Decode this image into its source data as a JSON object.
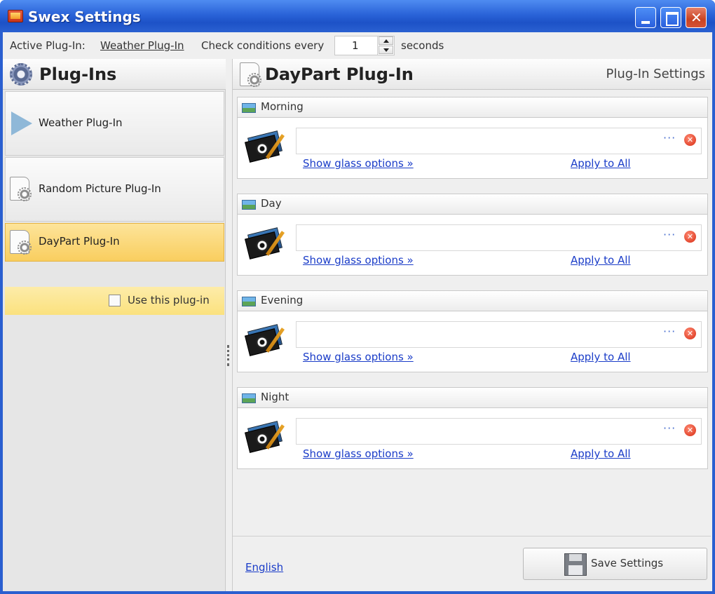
{
  "window": {
    "title": "Swex Settings"
  },
  "toolbar": {
    "active_label": "Active Plug-In:",
    "active_value": "Weather Plug-In",
    "check_label": "Check conditions every",
    "interval_value": "1",
    "interval_unit": "seconds"
  },
  "sidebar": {
    "title": "Plug-Ins",
    "items": [
      {
        "label": "Weather Plug-In"
      },
      {
        "label": "Random Picture Plug-In"
      },
      {
        "label": "DayPart Plug-In"
      }
    ],
    "use_label": "Use this plug-in",
    "use_checked": false
  },
  "main": {
    "title": "DayPart Plug-In",
    "subtitle": "Plug-In Settings",
    "sections": [
      {
        "title": "Morning",
        "path": "",
        "browse": "···",
        "glass_link": "Show glass options »",
        "apply_link": "Apply to All"
      },
      {
        "title": "Day",
        "path": "",
        "browse": "···",
        "glass_link": "Show glass options »",
        "apply_link": "Apply to All"
      },
      {
        "title": "Evening",
        "path": "",
        "browse": "···",
        "glass_link": "Show glass options »",
        "apply_link": "Apply to All"
      },
      {
        "title": "Night",
        "path": "",
        "browse": "···",
        "glass_link": "Show glass options »",
        "apply_link": "Apply to All"
      }
    ]
  },
  "footer": {
    "language": "English",
    "save_label": "Save Settings"
  },
  "colors": {
    "titlebar": "#2a5fd0",
    "selected_item": "#f9ce5f",
    "link": "#1a3cc8",
    "clear_icon": "#d72b12"
  }
}
